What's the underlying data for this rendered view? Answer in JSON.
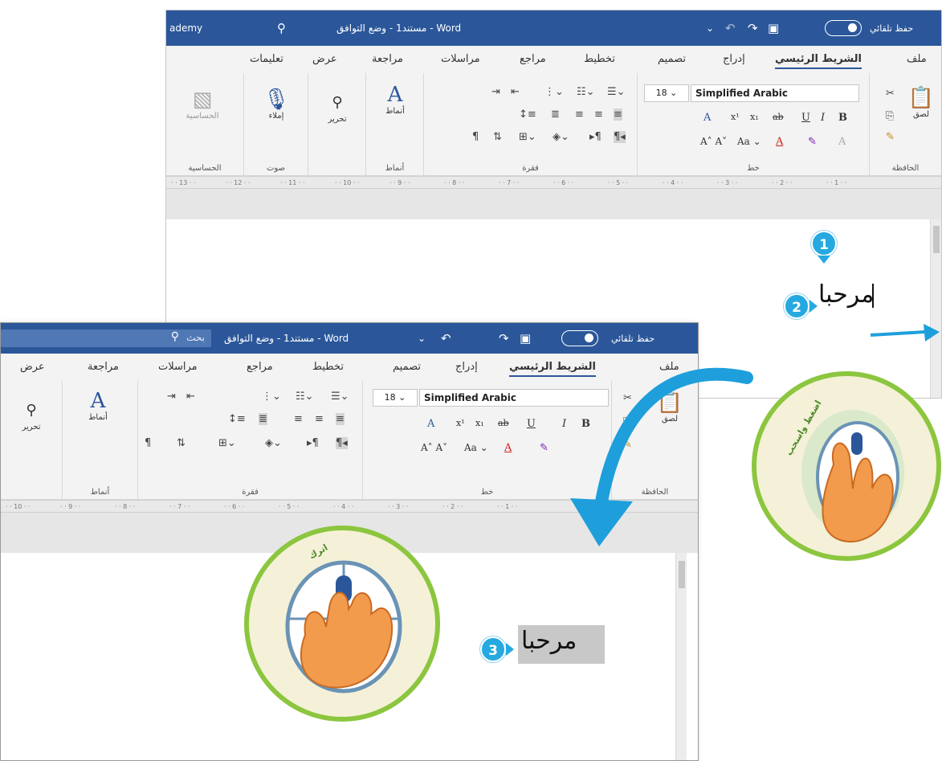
{
  "back_window": {
    "title": "مستند1 - وضع التوافق - Word",
    "left_title_text": "ademy",
    "autosave_label": "حفظ تلقائي",
    "autosave_toggle": "on",
    "tabs": [
      "ملف",
      "الشريط الرئيسي",
      "إدراج",
      "تصميم",
      "تخطيط",
      "مراجع",
      "مراسلات",
      "مراجعة",
      "عرض",
      "تعليمات"
    ],
    "active_tab": "الشريط الرئيسي",
    "font_name": "Simplified Arabic",
    "font_size": "18",
    "groups": {
      "clipboard": "الحافظة",
      "font": "خط",
      "paragraph": "فقرة",
      "styles": "أنماط",
      "editing": "تحرير",
      "voice": "صوت",
      "sensitivity": "الحساسية"
    },
    "buttons": {
      "paste": "لصق",
      "styles": "أنماط",
      "editing": "تحرير",
      "dictate": "إملاء",
      "sensitivity": "الحساسية"
    },
    "ruler_numbers": [
      "13",
      "12",
      "11",
      "10",
      "9",
      "8",
      "7",
      "6",
      "5",
      "4",
      "3",
      "2",
      "1"
    ],
    "document_text": "مرحبا",
    "step_badges": [
      "1",
      "2"
    ]
  },
  "front_window": {
    "title": "مستند1 - وضع التوافق - Word",
    "search_placeholder": "بحث",
    "autosave_label": "حفظ تلقائي",
    "autosave_toggle": "on",
    "tabs": [
      "ملف",
      "الشريط الرئيسي",
      "إدراج",
      "تصميم",
      "تخطيط",
      "مراجع",
      "مراسلات",
      "مراجعة",
      "عرض"
    ],
    "active_tab": "الشريط الرئيسي",
    "font_name": "Simplified Arabic",
    "font_size": "18",
    "groups": {
      "clipboard": "الحافظة",
      "font": "خط",
      "paragraph": "فقرة",
      "styles": "أنماط"
    },
    "buttons": {
      "paste": "لصق",
      "styles": "أنماط",
      "editing": "تحرير"
    },
    "ruler_numbers": [
      "10",
      "9",
      "8",
      "7",
      "6",
      "5",
      "4",
      "3",
      "2",
      "1"
    ],
    "document_text": "مرحبا",
    "step_badge": "3"
  },
  "illustrations": {
    "drag_circle_label": "اضغط واسحب",
    "release_circle_label": "اترك"
  },
  "colors": {
    "titlebar": "#2b579a",
    "badge": "#26a9e0",
    "circle_border": "#8cc63f",
    "selection": "#c8c8c8",
    "arrow": "#1e9fdc"
  }
}
